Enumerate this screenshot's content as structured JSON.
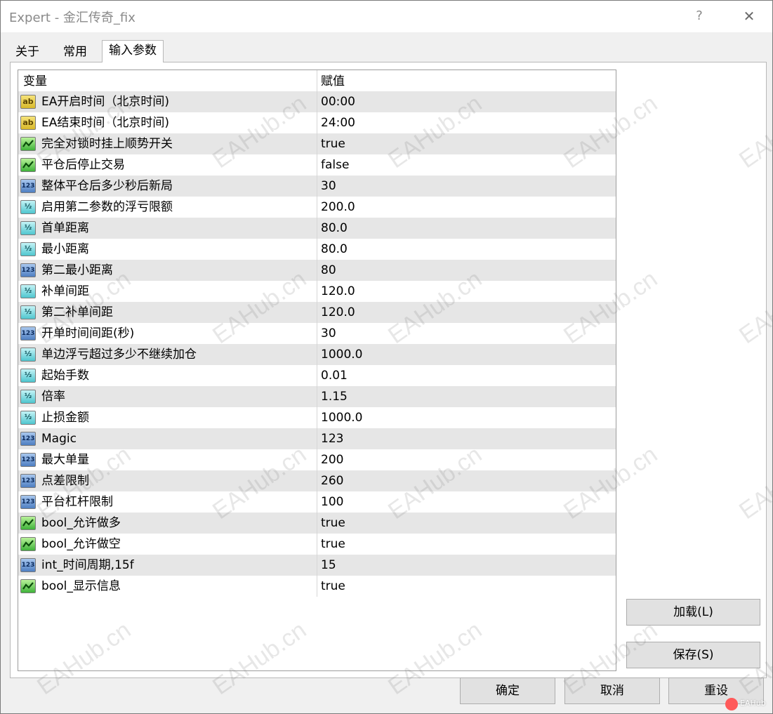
{
  "window": {
    "title": "Expert - 金汇传奇_fix",
    "help_glyph": "?",
    "close_glyph": "✕"
  },
  "tabs": [
    {
      "label": "关于",
      "active": false
    },
    {
      "label": "常用",
      "active": false
    },
    {
      "label": "输入参数",
      "active": true
    }
  ],
  "grid": {
    "col_variable": "变量",
    "col_value": "赋值",
    "rows": [
      {
        "type": "string",
        "icon": "string-ab-icon",
        "name": "EA开启时间（北京时间)",
        "value": "00:00"
      },
      {
        "type": "string",
        "icon": "string-ab-icon",
        "name": "EA结束时间（北京时间)",
        "value": "24:00"
      },
      {
        "type": "bool",
        "icon": "bool-icon",
        "name": "完全对锁时挂上顺势开关",
        "value": "true"
      },
      {
        "type": "bool",
        "icon": "bool-icon",
        "name": "平仓后停止交易",
        "value": "false"
      },
      {
        "type": "int",
        "icon": "integer-123-icon",
        "name": "整体平仓后多少秒后新局",
        "value": "30"
      },
      {
        "type": "double",
        "icon": "double-half-icon",
        "name": "启用第二参数的浮亏限额",
        "value": "200.0"
      },
      {
        "type": "double",
        "icon": "double-half-icon",
        "name": "首单距离",
        "value": "80.0"
      },
      {
        "type": "double",
        "icon": "double-half-icon",
        "name": "最小距离",
        "value": "80.0"
      },
      {
        "type": "int",
        "icon": "integer-123-icon",
        "name": "第二最小距离",
        "value": "80"
      },
      {
        "type": "double",
        "icon": "double-half-icon",
        "name": "补单间距",
        "value": "120.0"
      },
      {
        "type": "double",
        "icon": "double-half-icon",
        "name": "第二补单间距",
        "value": "120.0"
      },
      {
        "type": "int",
        "icon": "integer-123-icon",
        "name": "开单时间间距(秒)",
        "value": "30"
      },
      {
        "type": "double",
        "icon": "double-half-icon",
        "name": "单边浮亏超过多少不继续加仓",
        "value": "1000.0"
      },
      {
        "type": "double",
        "icon": "double-half-icon",
        "name": "起始手数",
        "value": "0.01"
      },
      {
        "type": "double",
        "icon": "double-half-icon",
        "name": "倍率",
        "value": "1.15"
      },
      {
        "type": "double",
        "icon": "double-half-icon",
        "name": "止损金额",
        "value": "1000.0"
      },
      {
        "type": "int",
        "icon": "integer-123-icon",
        "name": "Magic",
        "value": "123"
      },
      {
        "type": "int",
        "icon": "integer-123-icon",
        "name": "最大单量",
        "value": "200"
      },
      {
        "type": "int",
        "icon": "integer-123-icon",
        "name": "点差限制",
        "value": "260"
      },
      {
        "type": "int",
        "icon": "integer-123-icon",
        "name": "平台杠杆限制",
        "value": "100"
      },
      {
        "type": "bool",
        "icon": "bool-icon",
        "name": "bool_允许做多",
        "value": "true"
      },
      {
        "type": "bool",
        "icon": "bool-icon",
        "name": "bool_允许做空",
        "value": "true"
      },
      {
        "type": "int",
        "icon": "integer-123-icon",
        "name": "int_时间周期,15f",
        "value": "15"
      },
      {
        "type": "bool",
        "icon": "bool-icon",
        "name": "bool_显示信息",
        "value": "true"
      }
    ]
  },
  "icon_glyphs": {
    "string": "ab",
    "int": "123",
    "double": "½"
  },
  "buttons": {
    "load": "加载(L)",
    "save": "保存(S)",
    "ok": "确定",
    "cancel": "取消",
    "reset": "重设"
  },
  "watermark": {
    "text": "EAHub.cn",
    "corner_logo_text": "EAHub"
  }
}
